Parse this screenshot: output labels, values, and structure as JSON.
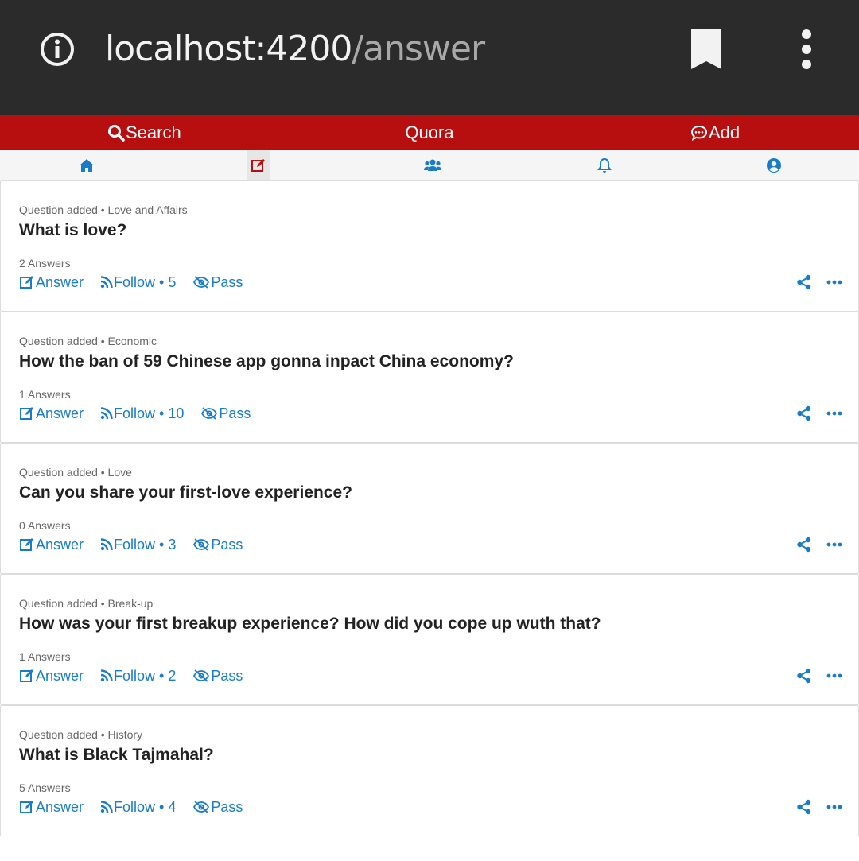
{
  "browser": {
    "url_host": "localhost:4200",
    "url_path": "/answer",
    "icons": [
      "info-icon",
      "bookmark-icon",
      "more-vert-icon"
    ]
  },
  "header": {
    "search_label": "Search",
    "title": "Quora",
    "add_label": "Add",
    "color": "#b70f0f"
  },
  "nav": {
    "tabs": [
      "home-icon",
      "edit-icon",
      "users-icon",
      "bell-icon",
      "user-circle-icon"
    ],
    "active": "edit-icon"
  },
  "questions": [
    {
      "meta": "Question added • Love and Affairs",
      "title": "What is love?",
      "answers": "2 Answers",
      "answer_label": "Answer",
      "follow_label": "Follow • 5",
      "pass_label": "Pass"
    },
    {
      "meta": "Question added • Economic",
      "title": "How the ban of 59 Chinese app gonna inpact China economy?",
      "answers": "1 Answers",
      "answer_label": "Answer",
      "follow_label": "Follow • 10",
      "pass_label": "Pass"
    },
    {
      "meta": "Question added • Love",
      "title": "Can you share your first-love experience?",
      "answers": "0 Answers",
      "answer_label": "Answer",
      "follow_label": "Follow • 3",
      "pass_label": "Pass"
    },
    {
      "meta": "Question added • Break-up",
      "title": "How was your first breakup experience? How did you cope up wuth that?",
      "answers": "1 Answers",
      "answer_label": "Answer",
      "follow_label": "Follow • 2",
      "pass_label": "Pass"
    },
    {
      "meta": "Question added • History",
      "title": "What is Black Tajmahal?",
      "answers": "5 Answers",
      "answer_label": "Answer",
      "follow_label": "Follow • 4",
      "pass_label": "Pass"
    }
  ],
  "colors": {
    "link": "#1a7cc7",
    "title": "#222222"
  }
}
